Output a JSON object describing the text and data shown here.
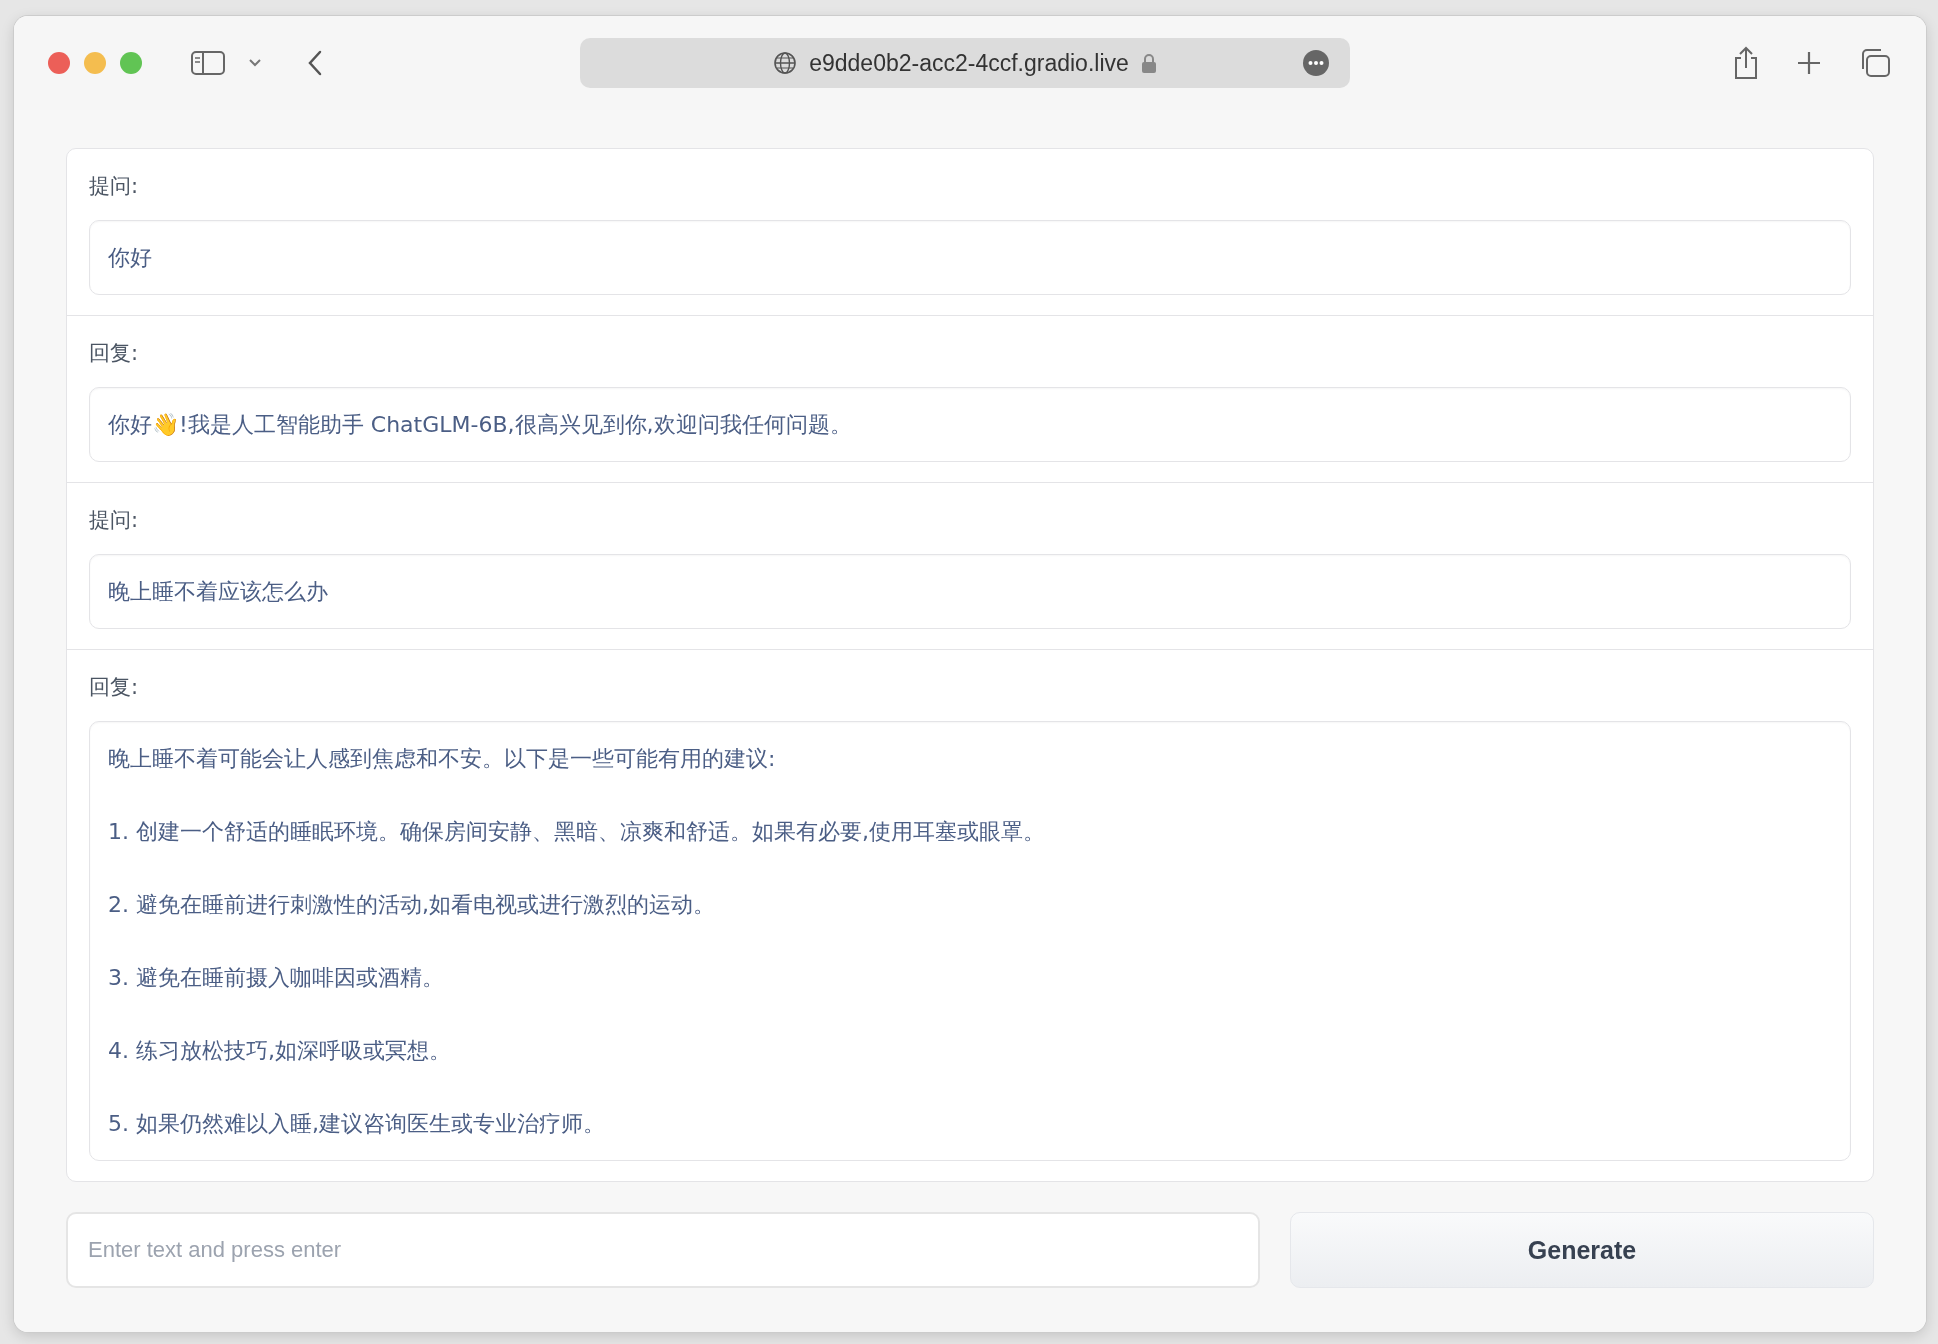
{
  "browser": {
    "url": "e9dde0b2-acc2-4ccf.gradio.live"
  },
  "messages": [
    {
      "label": "提问:",
      "paragraphs": [
        "你好"
      ]
    },
    {
      "label": "回复:",
      "paragraphs": [
        "你好👋!我是人工智能助手 ChatGLM-6B,很高兴见到你,欢迎问我任何问题。"
      ]
    },
    {
      "label": "提问:",
      "paragraphs": [
        "晚上睡不着应该怎么办"
      ]
    },
    {
      "label": "回复:",
      "paragraphs": [
        "晚上睡不着可能会让人感到焦虑和不安。以下是一些可能有用的建议:",
        "1. 创建一个舒适的睡眠环境。确保房间安静、黑暗、凉爽和舒适。如果有必要,使用耳塞或眼罩。",
        "2. 避免在睡前进行刺激性的活动,如看电视或进行激烈的运动。",
        "3. 避免在睡前摄入咖啡因或酒精。",
        "4. 练习放松技巧,如深呼吸或冥想。",
        "5. 如果仍然难以入睡,建议咨询医生或专业治疗师。"
      ]
    }
  ],
  "input": {
    "placeholder": "Enter text and press enter"
  },
  "generate_button": {
    "label": "Generate"
  }
}
